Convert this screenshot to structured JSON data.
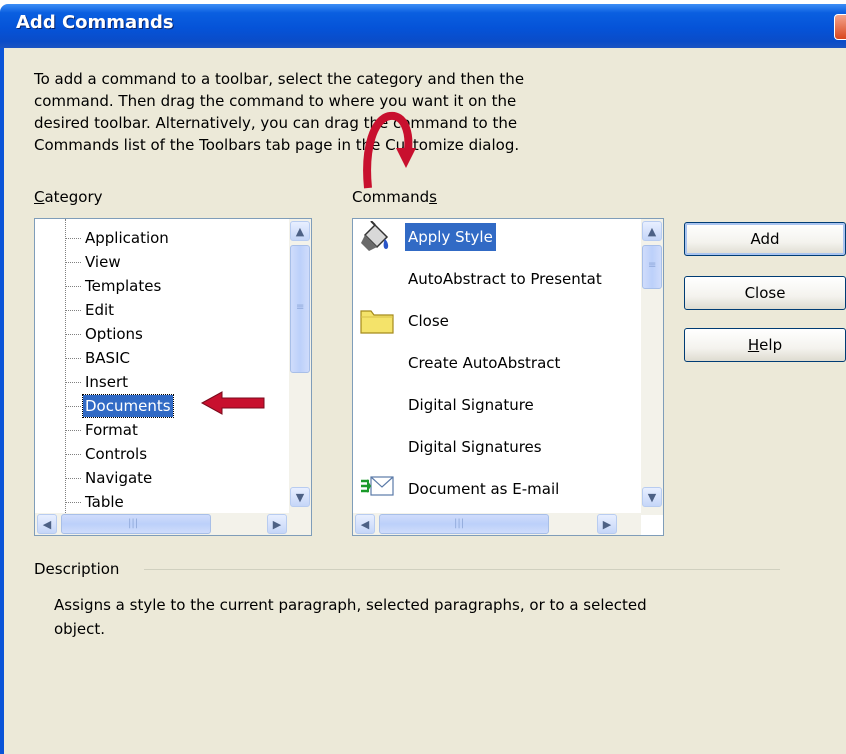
{
  "window": {
    "title": "Add Commands"
  },
  "instructions": [
    "To add a command to a toolbar, select the category and then the",
    "command. Then drag the command to where you want it on the",
    "desired toolbar. Alternatively, you can drag the command to the",
    "Commands list of the Toolbars tab page in the Customize dialog."
  ],
  "category": {
    "label_first": "C",
    "label_rest": "ategory",
    "items": [
      "Application",
      "View",
      "Templates",
      "Edit",
      "Options",
      "BASIC",
      "Insert",
      "Documents",
      "Format",
      "Controls",
      "Navigate",
      "Table"
    ],
    "selected": "Documents"
  },
  "commands": {
    "label_main": "Command",
    "label_accel": "s",
    "items": [
      {
        "label": "Apply Style",
        "icon": "paint-bucket-icon",
        "selected": true
      },
      {
        "label": "AutoAbstract to Presentat",
        "icon": "",
        "selected": false
      },
      {
        "label": "Close",
        "icon": "folder-icon",
        "selected": false
      },
      {
        "label": "Create AutoAbstract",
        "icon": "",
        "selected": false
      },
      {
        "label": "Digital Signature",
        "icon": "",
        "selected": false
      },
      {
        "label": "Digital Signatures",
        "icon": "",
        "selected": false
      },
      {
        "label": "Document as E-mail",
        "icon": "envelope-icon",
        "selected": false
      }
    ]
  },
  "buttons": {
    "add": "Add",
    "close": "Close",
    "help_accel": "H",
    "help_rest": "elp"
  },
  "description": {
    "label": "Description",
    "lines": [
      "Assigns a style to the current paragraph, selected paragraphs, or to a selected",
      "object."
    ]
  },
  "colors": {
    "selection": "#316ac5",
    "titlebar": "#0553d8",
    "dialog_bg": "#ece9d8",
    "annotation_arrow": "#c8102e"
  }
}
